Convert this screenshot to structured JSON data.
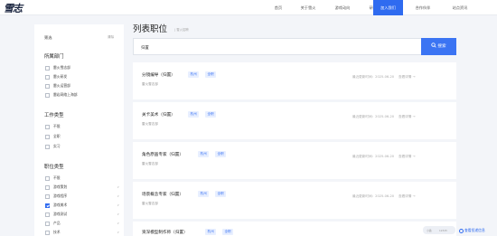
{
  "logo": {
    "text": "雪志"
  },
  "nav": [
    {
      "label": "首页",
      "active": false
    },
    {
      "label": "关于雪火",
      "active": false
    },
    {
      "label": "游戏动向",
      "active": false
    },
    {
      "label": "研发实力",
      "active": false
    },
    {
      "label": "加入我们",
      "active": true
    },
    {
      "label": "合作伙伴",
      "active": false
    },
    {
      "label": "站点资讯",
      "active": false
    }
  ],
  "sidebar": {
    "filter_label": "筛选",
    "clear_label": "清除",
    "dept_title": "所属部门",
    "depts": [
      {
        "label": "雷火雪志部",
        "checked": false
      },
      {
        "label": "雷火研发",
        "checked": false
      },
      {
        "label": "雷火运营部",
        "checked": false
      },
      {
        "label": "雷岩网络上海部",
        "checked": false
      }
    ],
    "worktype_title": "工作类型",
    "worktypes": [
      {
        "label": "不限",
        "checked": false
      },
      {
        "label": "全职",
        "checked": false
      },
      {
        "label": "实习",
        "checked": false
      }
    ],
    "jobtype_title": "职位类型",
    "jobtypes": [
      {
        "label": "不限",
        "checked": false
      },
      {
        "label": "游戏策划",
        "checked": false
      },
      {
        "label": "游戏程序",
        "checked": false
      },
      {
        "label": "游戏美术",
        "checked": true
      },
      {
        "label": "游戏测试",
        "checked": false
      },
      {
        "label": "产品",
        "checked": false
      },
      {
        "label": "技术",
        "checked": false
      }
    ]
  },
  "header": {
    "title": "列表职位",
    "subtitle": "| 雪火招聘"
  },
  "search": {
    "value": "归置",
    "button_label": "搜索"
  },
  "jobs": [
    {
      "title": "分镜编导（归置）",
      "tags": [
        "杭州",
        "全职"
      ],
      "org": "雷火雪志部",
      "date": "最近更新时间：2025-06-20",
      "detail": "查看详情 →"
    },
    {
      "title": "关卡美术（归置）",
      "tags": [
        "杭州",
        "全职"
      ],
      "org": "雷火雪志部",
      "date": "最近更新时间：2025-06-20",
      "detail": "查看详情 →"
    },
    {
      "title": "角色原画专家（归置）",
      "tags": [
        "杭州",
        "全职"
      ],
      "org": "雷火雪志部",
      "date": "最近更新时间：2025-06-20",
      "detail": "查看详情 →"
    },
    {
      "title": "场景概念专家（归置）",
      "tags": [
        "杭州",
        "全职"
      ],
      "org": "雷火雪志部",
      "date": "最近更新时间：2025-06-20",
      "detail": "查看详情 →"
    },
    {
      "title": "资深模型制作师（归置）",
      "tags": [
        "杭州",
        "全职"
      ],
      "org": "雷火雪志部",
      "date": "最近更新时间：2025-06-20",
      "detail": "查看详情 →"
    }
  ],
  "floating": {
    "badge_left": "小猫",
    "badge_right": "12345",
    "link_label": "查看投递信息"
  },
  "colors": {
    "accent": "#2f6bf0",
    "tag_bg": "#e8efff",
    "page_bg": "#f3f5f9"
  }
}
